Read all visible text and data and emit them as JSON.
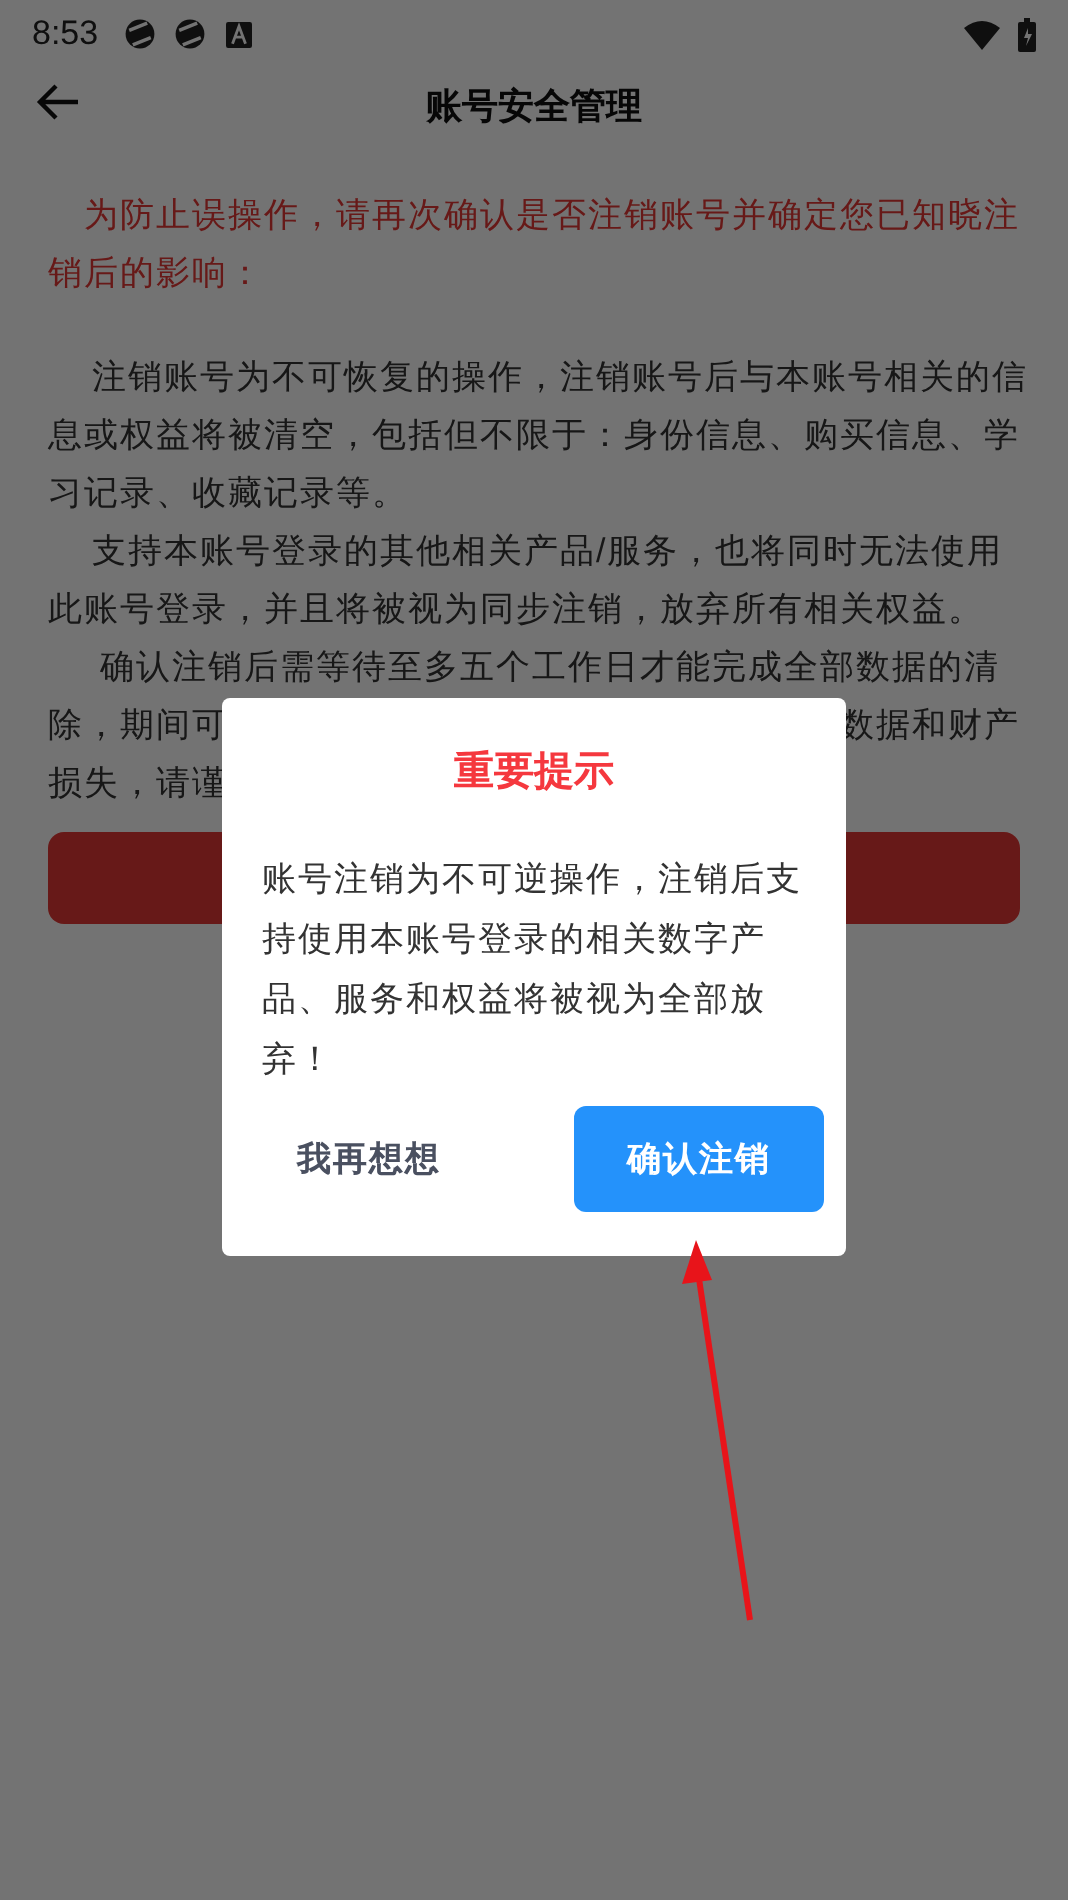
{
  "status_bar": {
    "time": "8:53"
  },
  "header": {
    "title": "账号安全管理"
  },
  "warning_lines": [
    "为防止误操作，请再次确认是否注销账号并确定您已知晓注",
    "销后的影响："
  ],
  "paragraphs": [
    {
      "lines": [
        {
          "left": "注销账号为不可恢复的操作，注销账号后与本账号相关的信"
        },
        {
          "left": "息或权益将被清空，包括但不限于：身份信息、购买信息、学"
        },
        {
          "left": "习记录、收藏记录等。"
        }
      ]
    },
    {
      "lines": [
        {
          "left": "支持本账号登录的其他相关产品/服务，也将同时无法使用"
        },
        {
          "left": "此账号登录，并且将被视为同步注销，放弃所有相关权益。"
        }
      ]
    },
    {
      "lines": [
        {
          "left": "确认注销后需等待至多五个工作日才能完成全部数据的清"
        },
        {
          "left": "除，期间可",
          "right": "数据和财产"
        },
        {
          "left": "损失，请谨"
        }
      ]
    }
  ],
  "dialog": {
    "title": "重要提示",
    "message": "账号注销为不可逆操作，注销后支持使用本账号登录的相关数字产品、服务和权益将被视为全部放弃！",
    "buttons": [
      {
        "label": "我再想想",
        "kind": "secondary"
      },
      {
        "label": "确认注销",
        "kind": "primary"
      }
    ]
  }
}
